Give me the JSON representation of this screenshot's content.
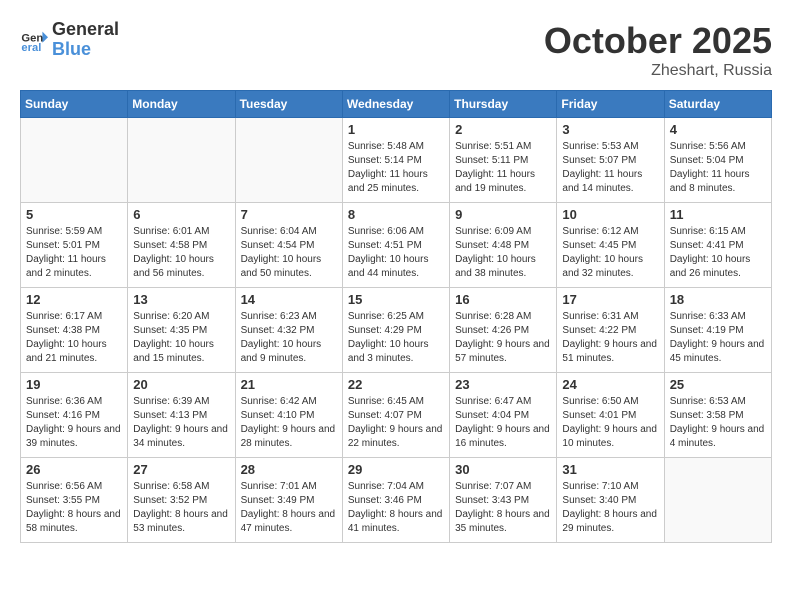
{
  "logo": {
    "line1": "General",
    "line2": "Blue"
  },
  "title": "October 2025",
  "location": "Zheshart, Russia",
  "days_header": [
    "Sunday",
    "Monday",
    "Tuesday",
    "Wednesday",
    "Thursday",
    "Friday",
    "Saturday"
  ],
  "weeks": [
    [
      {
        "num": "",
        "sunrise": "",
        "sunset": "",
        "daylight": ""
      },
      {
        "num": "",
        "sunrise": "",
        "sunset": "",
        "daylight": ""
      },
      {
        "num": "",
        "sunrise": "",
        "sunset": "",
        "daylight": ""
      },
      {
        "num": "1",
        "sunrise": "Sunrise: 5:48 AM",
        "sunset": "Sunset: 5:14 PM",
        "daylight": "Daylight: 11 hours and 25 minutes."
      },
      {
        "num": "2",
        "sunrise": "Sunrise: 5:51 AM",
        "sunset": "Sunset: 5:11 PM",
        "daylight": "Daylight: 11 hours and 19 minutes."
      },
      {
        "num": "3",
        "sunrise": "Sunrise: 5:53 AM",
        "sunset": "Sunset: 5:07 PM",
        "daylight": "Daylight: 11 hours and 14 minutes."
      },
      {
        "num": "4",
        "sunrise": "Sunrise: 5:56 AM",
        "sunset": "Sunset: 5:04 PM",
        "daylight": "Daylight: 11 hours and 8 minutes."
      }
    ],
    [
      {
        "num": "5",
        "sunrise": "Sunrise: 5:59 AM",
        "sunset": "Sunset: 5:01 PM",
        "daylight": "Daylight: 11 hours and 2 minutes."
      },
      {
        "num": "6",
        "sunrise": "Sunrise: 6:01 AM",
        "sunset": "Sunset: 4:58 PM",
        "daylight": "Daylight: 10 hours and 56 minutes."
      },
      {
        "num": "7",
        "sunrise": "Sunrise: 6:04 AM",
        "sunset": "Sunset: 4:54 PM",
        "daylight": "Daylight: 10 hours and 50 minutes."
      },
      {
        "num": "8",
        "sunrise": "Sunrise: 6:06 AM",
        "sunset": "Sunset: 4:51 PM",
        "daylight": "Daylight: 10 hours and 44 minutes."
      },
      {
        "num": "9",
        "sunrise": "Sunrise: 6:09 AM",
        "sunset": "Sunset: 4:48 PM",
        "daylight": "Daylight: 10 hours and 38 minutes."
      },
      {
        "num": "10",
        "sunrise": "Sunrise: 6:12 AM",
        "sunset": "Sunset: 4:45 PM",
        "daylight": "Daylight: 10 hours and 32 minutes."
      },
      {
        "num": "11",
        "sunrise": "Sunrise: 6:15 AM",
        "sunset": "Sunset: 4:41 PM",
        "daylight": "Daylight: 10 hours and 26 minutes."
      }
    ],
    [
      {
        "num": "12",
        "sunrise": "Sunrise: 6:17 AM",
        "sunset": "Sunset: 4:38 PM",
        "daylight": "Daylight: 10 hours and 21 minutes."
      },
      {
        "num": "13",
        "sunrise": "Sunrise: 6:20 AM",
        "sunset": "Sunset: 4:35 PM",
        "daylight": "Daylight: 10 hours and 15 minutes."
      },
      {
        "num": "14",
        "sunrise": "Sunrise: 6:23 AM",
        "sunset": "Sunset: 4:32 PM",
        "daylight": "Daylight: 10 hours and 9 minutes."
      },
      {
        "num": "15",
        "sunrise": "Sunrise: 6:25 AM",
        "sunset": "Sunset: 4:29 PM",
        "daylight": "Daylight: 10 hours and 3 minutes."
      },
      {
        "num": "16",
        "sunrise": "Sunrise: 6:28 AM",
        "sunset": "Sunset: 4:26 PM",
        "daylight": "Daylight: 9 hours and 57 minutes."
      },
      {
        "num": "17",
        "sunrise": "Sunrise: 6:31 AM",
        "sunset": "Sunset: 4:22 PM",
        "daylight": "Daylight: 9 hours and 51 minutes."
      },
      {
        "num": "18",
        "sunrise": "Sunrise: 6:33 AM",
        "sunset": "Sunset: 4:19 PM",
        "daylight": "Daylight: 9 hours and 45 minutes."
      }
    ],
    [
      {
        "num": "19",
        "sunrise": "Sunrise: 6:36 AM",
        "sunset": "Sunset: 4:16 PM",
        "daylight": "Daylight: 9 hours and 39 minutes."
      },
      {
        "num": "20",
        "sunrise": "Sunrise: 6:39 AM",
        "sunset": "Sunset: 4:13 PM",
        "daylight": "Daylight: 9 hours and 34 minutes."
      },
      {
        "num": "21",
        "sunrise": "Sunrise: 6:42 AM",
        "sunset": "Sunset: 4:10 PM",
        "daylight": "Daylight: 9 hours and 28 minutes."
      },
      {
        "num": "22",
        "sunrise": "Sunrise: 6:45 AM",
        "sunset": "Sunset: 4:07 PM",
        "daylight": "Daylight: 9 hours and 22 minutes."
      },
      {
        "num": "23",
        "sunrise": "Sunrise: 6:47 AM",
        "sunset": "Sunset: 4:04 PM",
        "daylight": "Daylight: 9 hours and 16 minutes."
      },
      {
        "num": "24",
        "sunrise": "Sunrise: 6:50 AM",
        "sunset": "Sunset: 4:01 PM",
        "daylight": "Daylight: 9 hours and 10 minutes."
      },
      {
        "num": "25",
        "sunrise": "Sunrise: 6:53 AM",
        "sunset": "Sunset: 3:58 PM",
        "daylight": "Daylight: 9 hours and 4 minutes."
      }
    ],
    [
      {
        "num": "26",
        "sunrise": "Sunrise: 6:56 AM",
        "sunset": "Sunset: 3:55 PM",
        "daylight": "Daylight: 8 hours and 58 minutes."
      },
      {
        "num": "27",
        "sunrise": "Sunrise: 6:58 AM",
        "sunset": "Sunset: 3:52 PM",
        "daylight": "Daylight: 8 hours and 53 minutes."
      },
      {
        "num": "28",
        "sunrise": "Sunrise: 7:01 AM",
        "sunset": "Sunset: 3:49 PM",
        "daylight": "Daylight: 8 hours and 47 minutes."
      },
      {
        "num": "29",
        "sunrise": "Sunrise: 7:04 AM",
        "sunset": "Sunset: 3:46 PM",
        "daylight": "Daylight: 8 hours and 41 minutes."
      },
      {
        "num": "30",
        "sunrise": "Sunrise: 7:07 AM",
        "sunset": "Sunset: 3:43 PM",
        "daylight": "Daylight: 8 hours and 35 minutes."
      },
      {
        "num": "31",
        "sunrise": "Sunrise: 7:10 AM",
        "sunset": "Sunset: 3:40 PM",
        "daylight": "Daylight: 8 hours and 29 minutes."
      },
      {
        "num": "",
        "sunrise": "",
        "sunset": "",
        "daylight": ""
      }
    ]
  ]
}
